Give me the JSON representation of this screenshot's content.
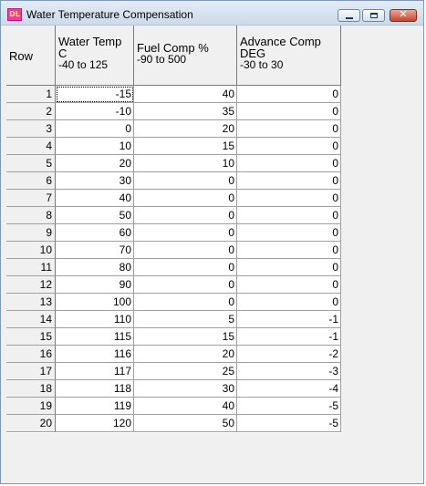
{
  "window": {
    "title": "Water Temperature Compensation",
    "icon_label": "DL",
    "close_glyph": "✕"
  },
  "table": {
    "headers": {
      "row": "Row",
      "water_temp": [
        "Water Temp",
        "C",
        "-40 to 125"
      ],
      "fuel_comp": [
        "Fuel Comp %",
        "-90 to 500"
      ],
      "advance_comp": [
        "Advance Comp",
        "DEG",
        "-30 to 30"
      ]
    },
    "rows": [
      {
        "row": "1",
        "water_temp": "-15",
        "fuel_comp": "40",
        "advance_comp": "0"
      },
      {
        "row": "2",
        "water_temp": "-10",
        "fuel_comp": "35",
        "advance_comp": "0"
      },
      {
        "row": "3",
        "water_temp": "0",
        "fuel_comp": "20",
        "advance_comp": "0"
      },
      {
        "row": "4",
        "water_temp": "10",
        "fuel_comp": "15",
        "advance_comp": "0"
      },
      {
        "row": "5",
        "water_temp": "20",
        "fuel_comp": "10",
        "advance_comp": "0"
      },
      {
        "row": "6",
        "water_temp": "30",
        "fuel_comp": "0",
        "advance_comp": "0"
      },
      {
        "row": "7",
        "water_temp": "40",
        "fuel_comp": "0",
        "advance_comp": "0"
      },
      {
        "row": "8",
        "water_temp": "50",
        "fuel_comp": "0",
        "advance_comp": "0"
      },
      {
        "row": "9",
        "water_temp": "60",
        "fuel_comp": "0",
        "advance_comp": "0"
      },
      {
        "row": "10",
        "water_temp": "70",
        "fuel_comp": "0",
        "advance_comp": "0"
      },
      {
        "row": "11",
        "water_temp": "80",
        "fuel_comp": "0",
        "advance_comp": "0"
      },
      {
        "row": "12",
        "water_temp": "90",
        "fuel_comp": "0",
        "advance_comp": "0"
      },
      {
        "row": "13",
        "water_temp": "100",
        "fuel_comp": "0",
        "advance_comp": "0"
      },
      {
        "row": "14",
        "water_temp": "110",
        "fuel_comp": "5",
        "advance_comp": "-1"
      },
      {
        "row": "15",
        "water_temp": "115",
        "fuel_comp": "15",
        "advance_comp": "-1"
      },
      {
        "row": "16",
        "water_temp": "116",
        "fuel_comp": "20",
        "advance_comp": "-2"
      },
      {
        "row": "17",
        "water_temp": "117",
        "fuel_comp": "25",
        "advance_comp": "-3"
      },
      {
        "row": "18",
        "water_temp": "118",
        "fuel_comp": "30",
        "advance_comp": "-4"
      },
      {
        "row": "19",
        "water_temp": "119",
        "fuel_comp": "40",
        "advance_comp": "-5"
      },
      {
        "row": "20",
        "water_temp": "120",
        "fuel_comp": "50",
        "advance_comp": "-5"
      }
    ]
  }
}
